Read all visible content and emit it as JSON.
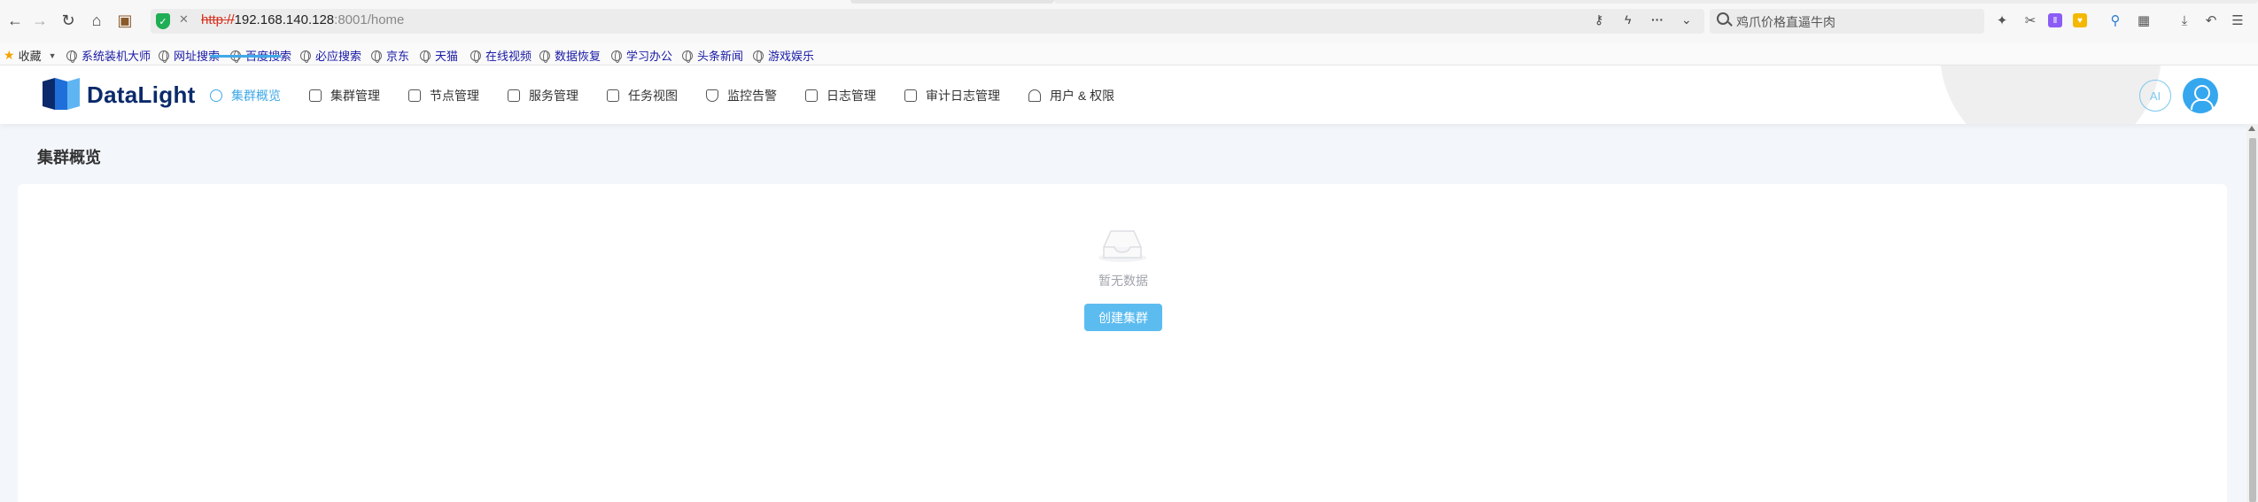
{
  "browser": {
    "url_protocol": "http://",
    "url_host": "192.168.140.128",
    "url_rest": ":8001/home",
    "insecure_label": "✕",
    "search_placeholder": "鸡爪价格直逼牛肉"
  },
  "bookmarks": {
    "favorites": "收藏",
    "items": [
      "系统装机大师",
      "网址搜索",
      "百度搜索",
      "必应搜索",
      "京东",
      "天猫",
      "在线视频",
      "数据恢复",
      "学习办公",
      "头条新闻",
      "游戏娱乐"
    ]
  },
  "app": {
    "logo_text": "DataLight",
    "nav": [
      {
        "label": "集群概览",
        "icon": "dashboard-icon",
        "active": true
      },
      {
        "label": "集群管理",
        "icon": "cluster-icon"
      },
      {
        "label": "节点管理",
        "icon": "node-icon"
      },
      {
        "label": "服务管理",
        "icon": "service-icon"
      },
      {
        "label": "任务视图",
        "icon": "task-icon"
      },
      {
        "label": "监控告警",
        "icon": "shield-icon"
      },
      {
        "label": "日志管理",
        "icon": "log-icon"
      },
      {
        "label": "审计日志管理",
        "icon": "audit-icon"
      },
      {
        "label": "用户 & 权限",
        "icon": "user-permission-icon"
      }
    ],
    "ai_label": "AI"
  },
  "page": {
    "title": "集群概览",
    "empty_text": "暂无数据",
    "create_button": "创建集群"
  },
  "colors": {
    "accent": "#40a9e8",
    "button": "#5cbcf0",
    "logo": "#0b2a6b",
    "background": "#f3f6fb"
  }
}
